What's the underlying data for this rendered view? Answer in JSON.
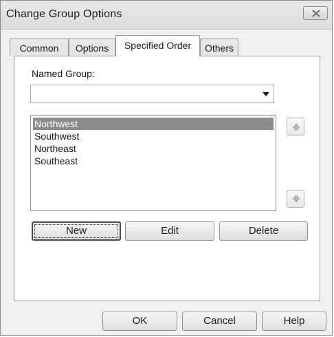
{
  "window": {
    "title": "Change Group Options"
  },
  "tabs": [
    {
      "label": "Common",
      "active": false
    },
    {
      "label": "Options",
      "active": false
    },
    {
      "label": "Specified Order",
      "active": true
    },
    {
      "label": "Others",
      "active": false
    }
  ],
  "named_group": {
    "label": "Named Group:",
    "value": ""
  },
  "group_list": {
    "items": [
      "Northwest",
      "Southwest",
      "Northeast",
      "Southeast"
    ],
    "selected": "Northwest"
  },
  "list_actions": {
    "new_label": "New",
    "edit_label": "Edit",
    "delete_label": "Delete"
  },
  "dialog_buttons": {
    "ok_label": "OK",
    "cancel_label": "Cancel",
    "help_label": "Help"
  },
  "icons": {
    "close": "close-icon",
    "move_up": "arrow-up-icon",
    "move_down": "arrow-down-icon",
    "dropdown": "chevron-down-icon"
  },
  "colors": {
    "dialog_background": "#f0f0f0",
    "selection_highlight": "#8c8c8c"
  }
}
